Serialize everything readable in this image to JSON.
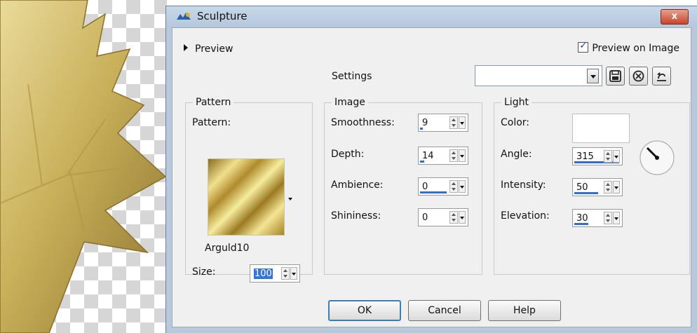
{
  "dialog": {
    "title": "Sculpture",
    "close_label": "x",
    "preview_label": "Preview",
    "preview_on_image_label": "Preview on Image",
    "preview_on_image_checked": true,
    "settings_label": "Settings",
    "preset_value": ""
  },
  "pattern": {
    "group_title": "Pattern",
    "pattern_label": "Pattern:",
    "pattern_name": "Arguld10",
    "size_label": "Size:",
    "size_value": "100"
  },
  "image": {
    "group_title": "Image",
    "smoothness_label": "Smoothness:",
    "smoothness_value": "9",
    "depth_label": "Depth:",
    "depth_value": "14",
    "ambience_label": "Ambience:",
    "ambience_value": "0",
    "shininess_label": "Shininess:",
    "shininess_value": "0"
  },
  "light": {
    "group_title": "Light",
    "color_label": "Color:",
    "color_value": "#ffffff",
    "angle_label": "Angle:",
    "angle_value": "315",
    "intensity_label": "Intensity:",
    "intensity_value": "50",
    "elevation_label": "Elevation:",
    "elevation_value": "30"
  },
  "buttons": {
    "ok": "OK",
    "cancel": "Cancel",
    "help": "Help"
  },
  "icons": {
    "app": "sculpture-app-icon",
    "save_preset": "floppy-disk-icon",
    "delete_preset": "delete-preset-icon",
    "reset": "reset-icon"
  }
}
